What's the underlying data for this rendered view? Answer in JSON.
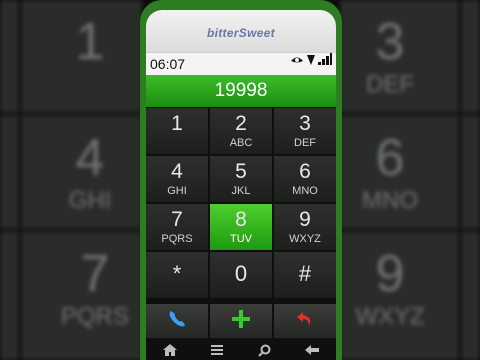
{
  "app": {
    "brand": "bitterSweet"
  },
  "status": {
    "time": "06:07"
  },
  "dialer": {
    "number": "19998",
    "keys": [
      {
        "digit": "1",
        "letters": ""
      },
      {
        "digit": "2",
        "letters": "ABC"
      },
      {
        "digit": "3",
        "letters": "DEF"
      },
      {
        "digit": "4",
        "letters": "GHI"
      },
      {
        "digit": "5",
        "letters": "JKL"
      },
      {
        "digit": "6",
        "letters": "MNO"
      },
      {
        "digit": "7",
        "letters": "PQRS"
      },
      {
        "digit": "8",
        "letters": "TUV"
      },
      {
        "digit": "9",
        "letters": "WXYZ"
      },
      {
        "digit": "*",
        "letters": ""
      },
      {
        "digit": "0",
        "letters": ""
      },
      {
        "digit": "#",
        "letters": ""
      }
    ],
    "active_key": "8"
  },
  "actions": {
    "call_icon": "phone-icon",
    "add_icon": "plus-icon",
    "back_icon": "hangup-back-icon"
  },
  "navbar": {
    "icons": [
      "home-icon",
      "menu-icon",
      "search-icon",
      "back-arrow-icon"
    ]
  },
  "colors": {
    "accent": "#2f7d22",
    "number_bar": "#2aa81c",
    "call": "#3aa0ff",
    "add": "#33cc33",
    "back": "#e0302a"
  },
  "background": {
    "left": [
      {
        "digit": "1",
        "letters": ""
      },
      {
        "digit": "4",
        "letters": "GHI"
      },
      {
        "digit": "7",
        "letters": "PQRS"
      }
    ],
    "right": [
      {
        "digit": "3",
        "letters": "DEF"
      },
      {
        "digit": "6",
        "letters": "MNO"
      },
      {
        "digit": "9",
        "letters": "WXYZ"
      }
    ]
  }
}
